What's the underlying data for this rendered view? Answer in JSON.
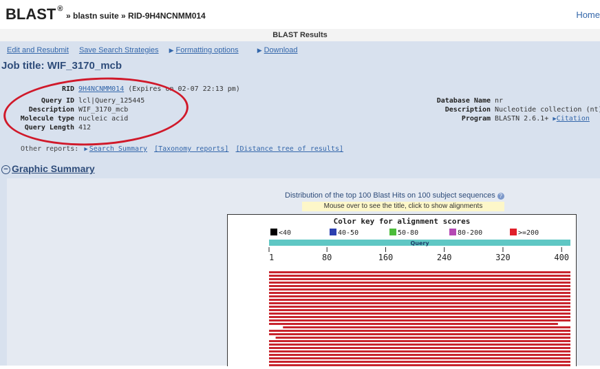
{
  "header": {
    "brand": "BLAST",
    "registered": "®",
    "breadcrumb": "» blastn suite » RID-9H4NCNMM014",
    "home": "Home"
  },
  "results_title": "BLAST Results",
  "links": {
    "edit": "Edit and Resubmit",
    "save": "Save Search Strategies",
    "formatting": "Formatting options",
    "download": "Download"
  },
  "job_title": "Job title: WIF_3170_mcb",
  "left_info": {
    "rid_label": "RID",
    "rid_value": "9H4NCNMM014",
    "rid_expires": "(Expires on 02-07 22:13 pm)",
    "query_id_label": "Query ID",
    "query_id_value": "lcl|Query_125445",
    "description_label": "Description",
    "description_value": "WIF_3170_mcb",
    "molecule_label": "Molecule type",
    "molecule_value": "nucleic acid",
    "length_label": "Query Length",
    "length_value": "412"
  },
  "right_info": {
    "db_label": "Database Name",
    "db_value": "nr",
    "desc_label": "Description",
    "desc_value": "Nucleotide collection (nt)",
    "program_label": "Program",
    "program_value": "BLASTN 2.6.1+",
    "citation": "Citation"
  },
  "other_reports": {
    "label": "Other reports:",
    "search_summary": "Search Summary",
    "taxonomy": "[Taxonomy reports]",
    "distance": "[Distance tree of results]"
  },
  "graphic_summary": {
    "heading": "Graphic Summary",
    "dist_title": "Distribution of the top 100 Blast Hits on 100 subject sequences",
    "mouse_hint": "Mouse over to see the title, click to show alignments"
  },
  "chart_data": {
    "type": "bar",
    "title": "Color key for alignment scores",
    "legend": [
      {
        "label": "<40",
        "color": "#000000"
      },
      {
        "label": "40-50",
        "color": "#2b3fb0"
      },
      {
        "label": "50-80",
        "color": "#4cbc3a"
      },
      {
        "label": "80-200",
        "color": "#b548b4"
      },
      {
        "label": ">=200",
        "color": "#e01f2a"
      }
    ],
    "query_label": "Query",
    "query_bar_color": "#5fc7c4",
    "x_ticks": [
      "1",
      "80",
      "160",
      "240",
      "320",
      "400"
    ],
    "x_range": [
      1,
      412
    ],
    "hit_color": "#c8242d",
    "hits": [
      {
        "start": 1,
        "end": 412
      },
      {
        "start": 1,
        "end": 412
      },
      {
        "start": 1,
        "end": 412
      },
      {
        "start": 1,
        "end": 412
      },
      {
        "start": 1,
        "end": 412
      },
      {
        "start": 1,
        "end": 412
      },
      {
        "start": 1,
        "end": 412
      },
      {
        "start": 1,
        "end": 412
      },
      {
        "start": 1,
        "end": 412
      },
      {
        "start": 1,
        "end": 412
      },
      {
        "start": 1,
        "end": 412
      },
      {
        "start": 1,
        "end": 412
      },
      {
        "start": 1,
        "end": 412
      },
      {
        "start": 1,
        "end": 412
      },
      {
        "start": 1,
        "end": 412
      },
      {
        "start": 1,
        "end": 395
      },
      {
        "start": 20,
        "end": 412
      },
      {
        "start": 1,
        "end": 412
      },
      {
        "start": 1,
        "end": 412
      },
      {
        "start": 10,
        "end": 412
      },
      {
        "start": 1,
        "end": 412
      },
      {
        "start": 1,
        "end": 412
      },
      {
        "start": 1,
        "end": 412
      },
      {
        "start": 1,
        "end": 412
      },
      {
        "start": 1,
        "end": 412
      },
      {
        "start": 1,
        "end": 412
      },
      {
        "start": 1,
        "end": 412
      },
      {
        "start": 1,
        "end": 412
      }
    ]
  }
}
